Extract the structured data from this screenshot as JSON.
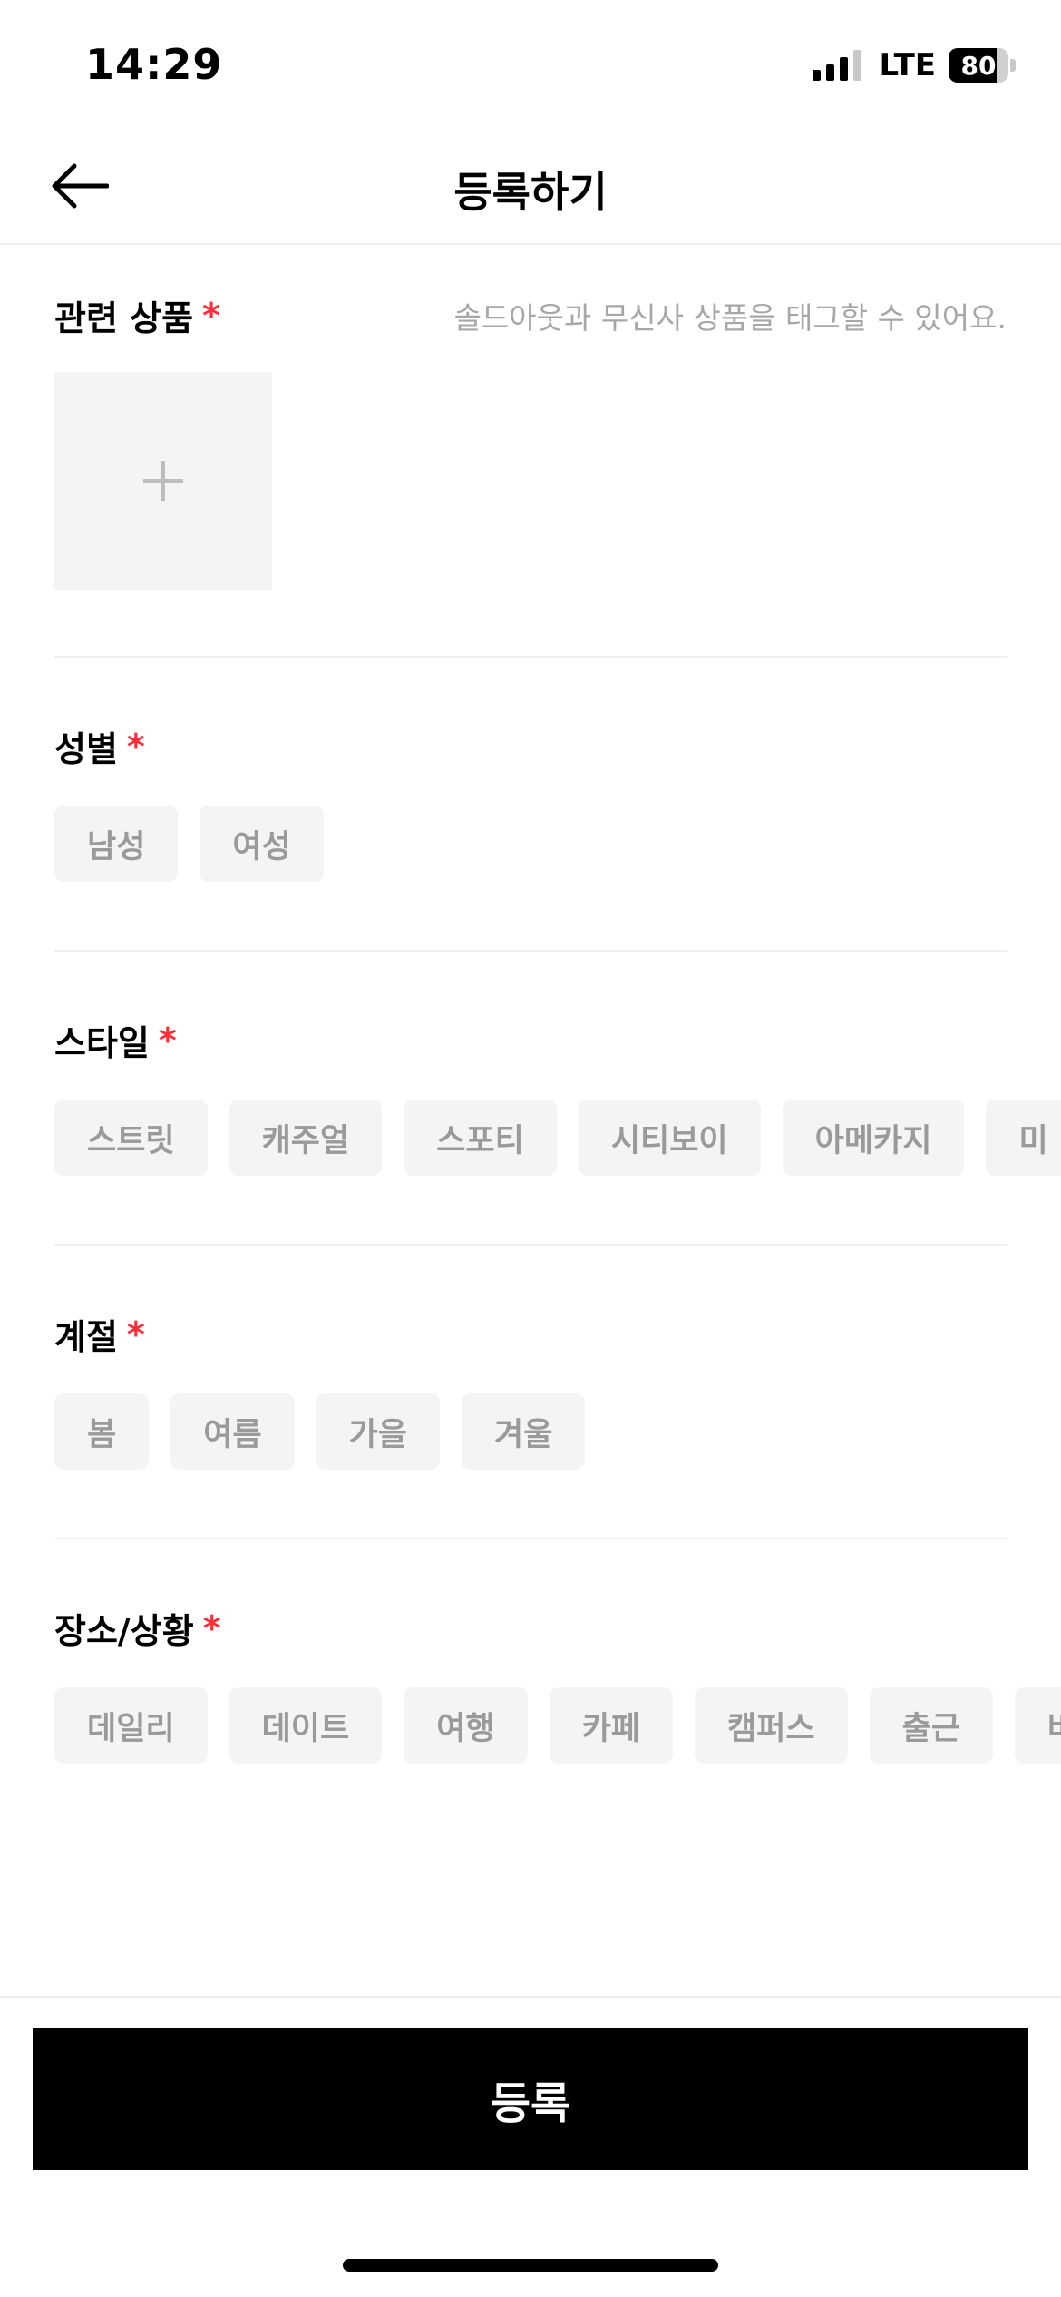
{
  "status_bar": {
    "time": "14:29",
    "network": "LTE",
    "battery": "80"
  },
  "header": {
    "title": "등록하기"
  },
  "sections": {
    "products": {
      "label": "관련 상품",
      "required": "*",
      "hint": "솔드아웃과 무신사 상품을 태그할 수 있어요."
    },
    "gender": {
      "label": "성별",
      "required": "*",
      "options": [
        "남성",
        "여성"
      ]
    },
    "style": {
      "label": "스타일",
      "required": "*",
      "options": [
        "스트릿",
        "캐주얼",
        "스포티",
        "시티보이",
        "아메카지",
        "미"
      ]
    },
    "season": {
      "label": "계절",
      "required": "*",
      "options": [
        "봄",
        "여름",
        "가을",
        "겨울"
      ]
    },
    "place": {
      "label": "장소/상황",
      "required": "*",
      "options": [
        "데일리",
        "데이트",
        "여행",
        "카페",
        "캠퍼스",
        "출근",
        "바"
      ]
    }
  },
  "footer": {
    "submit_label": "등록"
  },
  "colors": {
    "required": "#ff2d3a",
    "chip_bg": "#f4f4f4",
    "chip_text": "#9a9a9a",
    "button_bg": "#000000"
  }
}
